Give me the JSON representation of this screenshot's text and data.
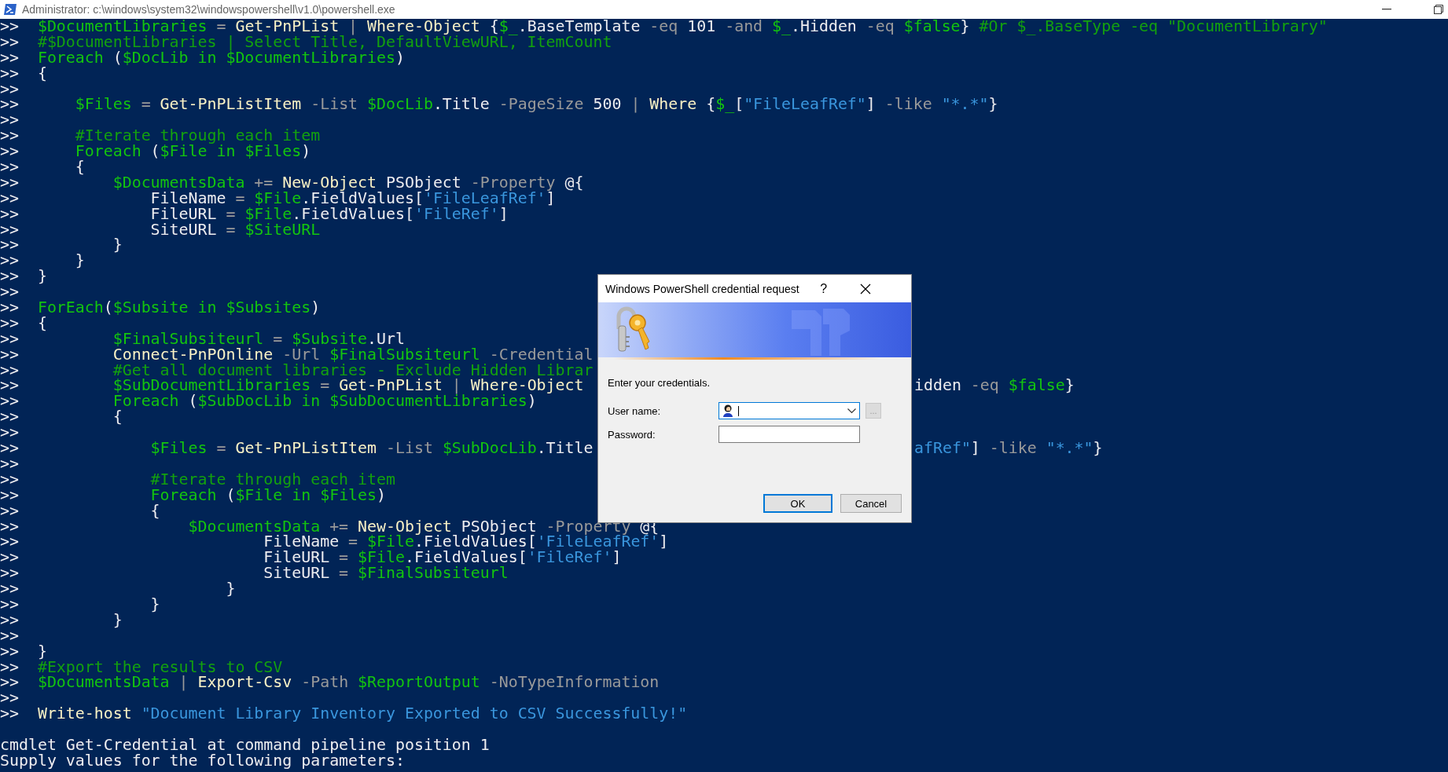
{
  "window": {
    "title": "Administrator: c:\\windows\\system32\\windowspowershell\\v1.0\\powershell.exe"
  },
  "console": {
    "lines": [
      {
        "kind": "input",
        "prompt": ">>",
        "tokens": [
          {
            "kind": "var",
            "text": "  $DocumentLibraries"
          },
          {
            "kind": "op",
            "text": " = "
          },
          {
            "kind": "cmd",
            "text": "Get-PnPList"
          },
          {
            "kind": "op",
            "text": " | "
          },
          {
            "kind": "cmd",
            "text": "Where-Object"
          },
          {
            "kind": "txt",
            "text": " {"
          },
          {
            "kind": "var",
            "text": "$_"
          },
          {
            "kind": "txt",
            "text": ".BaseTemplate"
          },
          {
            "kind": "param",
            "text": " -eq "
          },
          {
            "kind": "txt",
            "text": "101"
          },
          {
            "kind": "param",
            "text": " -and "
          },
          {
            "kind": "var",
            "text": "$_"
          },
          {
            "kind": "txt",
            "text": ".Hidden"
          },
          {
            "kind": "param",
            "text": " -eq "
          },
          {
            "kind": "var",
            "text": "$false"
          },
          {
            "kind": "txt",
            "text": "} "
          },
          {
            "kind": "com",
            "text": "#Or $_.BaseType -eq \"DocumentLibrary\""
          }
        ]
      },
      {
        "kind": "input",
        "prompt": ">>",
        "tokens": [
          {
            "kind": "com",
            "text": "  #$DocumentLibraries | Select Title, DefaultViewURL, ItemCount"
          }
        ]
      },
      {
        "kind": "input",
        "prompt": ">>",
        "tokens": [
          {
            "kind": "kw",
            "text": "  Foreach"
          },
          {
            "kind": "txt",
            "text": " ("
          },
          {
            "kind": "var",
            "text": "$DocLib"
          },
          {
            "kind": "kw",
            "text": " in "
          },
          {
            "kind": "var",
            "text": "$DocumentLibraries"
          },
          {
            "kind": "txt",
            "text": ")"
          }
        ]
      },
      {
        "kind": "input",
        "prompt": ">>",
        "tokens": [
          {
            "kind": "txt",
            "text": "  {"
          }
        ]
      },
      {
        "kind": "input",
        "prompt": ">>"
      },
      {
        "kind": "input",
        "prompt": ">>",
        "tokens": [
          {
            "kind": "var",
            "text": "      $Files"
          },
          {
            "kind": "op",
            "text": " = "
          },
          {
            "kind": "cmd",
            "text": "Get-PnPListItem"
          },
          {
            "kind": "param",
            "text": " -List "
          },
          {
            "kind": "var",
            "text": "$DocLib"
          },
          {
            "kind": "txt",
            "text": ".Title"
          },
          {
            "kind": "param",
            "text": " -PageSize "
          },
          {
            "kind": "txt",
            "text": "500"
          },
          {
            "kind": "op",
            "text": " | "
          },
          {
            "kind": "cmd",
            "text": "Where"
          },
          {
            "kind": "txt",
            "text": " {"
          },
          {
            "kind": "var",
            "text": "$_"
          },
          {
            "kind": "txt",
            "text": "["
          },
          {
            "kind": "str",
            "text": "\"FileLeafRef\""
          },
          {
            "kind": "txt",
            "text": "] "
          },
          {
            "kind": "param",
            "text": "-like "
          },
          {
            "kind": "str",
            "text": "\"*.*\""
          },
          {
            "kind": "txt",
            "text": "}"
          }
        ]
      },
      {
        "kind": "input",
        "prompt": ">>"
      },
      {
        "kind": "input",
        "prompt": ">>",
        "tokens": [
          {
            "kind": "com",
            "text": "      #Iterate through each item"
          }
        ]
      },
      {
        "kind": "input",
        "prompt": ">>",
        "tokens": [
          {
            "kind": "kw",
            "text": "      Foreach"
          },
          {
            "kind": "txt",
            "text": " ("
          },
          {
            "kind": "var",
            "text": "$File"
          },
          {
            "kind": "kw",
            "text": " in "
          },
          {
            "kind": "var",
            "text": "$Files"
          },
          {
            "kind": "txt",
            "text": ")"
          }
        ]
      },
      {
        "kind": "input",
        "prompt": ">>",
        "tokens": [
          {
            "kind": "txt",
            "text": "      {"
          }
        ]
      },
      {
        "kind": "input",
        "prompt": ">>",
        "tokens": [
          {
            "kind": "var",
            "text": "          $DocumentsData"
          },
          {
            "kind": "op",
            "text": " += "
          },
          {
            "kind": "cmd",
            "text": "New-Object"
          },
          {
            "kind": "txt",
            "text": " PSObject"
          },
          {
            "kind": "param",
            "text": " -Property "
          },
          {
            "kind": "txt",
            "text": "@{"
          }
        ]
      },
      {
        "kind": "input",
        "prompt": ">>",
        "tokens": [
          {
            "kind": "txt",
            "text": "              FileName "
          },
          {
            "kind": "op",
            "text": "= "
          },
          {
            "kind": "var",
            "text": "$File"
          },
          {
            "kind": "txt",
            "text": ".FieldValues["
          },
          {
            "kind": "str",
            "text": "'FileLeafRef'"
          },
          {
            "kind": "txt",
            "text": "]"
          }
        ]
      },
      {
        "kind": "input",
        "prompt": ">>",
        "tokens": [
          {
            "kind": "txt",
            "text": "              FileURL "
          },
          {
            "kind": "op",
            "text": "= "
          },
          {
            "kind": "var",
            "text": "$File"
          },
          {
            "kind": "txt",
            "text": ".FieldValues["
          },
          {
            "kind": "str",
            "text": "'FileRef'"
          },
          {
            "kind": "txt",
            "text": "]"
          }
        ]
      },
      {
        "kind": "input",
        "prompt": ">>",
        "tokens": [
          {
            "kind": "txt",
            "text": "              SiteURL "
          },
          {
            "kind": "op",
            "text": "= "
          },
          {
            "kind": "var",
            "text": "$SiteURL"
          }
        ]
      },
      {
        "kind": "input",
        "prompt": ">>",
        "tokens": [
          {
            "kind": "txt",
            "text": "          }"
          }
        ]
      },
      {
        "kind": "input",
        "prompt": ">>",
        "tokens": [
          {
            "kind": "txt",
            "text": "      }"
          }
        ]
      },
      {
        "kind": "input",
        "prompt": ">>",
        "tokens": [
          {
            "kind": "txt",
            "text": "  }"
          }
        ]
      },
      {
        "kind": "input",
        "prompt": ">>"
      },
      {
        "kind": "input",
        "prompt": ">>",
        "tokens": [
          {
            "kind": "kw",
            "text": "  ForEach"
          },
          {
            "kind": "txt",
            "text": "("
          },
          {
            "kind": "var",
            "text": "$Subsite"
          },
          {
            "kind": "kw",
            "text": " in "
          },
          {
            "kind": "var",
            "text": "$Subsites"
          },
          {
            "kind": "txt",
            "text": ")"
          }
        ]
      },
      {
        "kind": "input",
        "prompt": ">>",
        "tokens": [
          {
            "kind": "txt",
            "text": "  {"
          }
        ]
      },
      {
        "kind": "input",
        "prompt": ">>",
        "tokens": [
          {
            "kind": "var",
            "text": "          $FinalSubsiteurl"
          },
          {
            "kind": "op",
            "text": " = "
          },
          {
            "kind": "var",
            "text": "$Subsite"
          },
          {
            "kind": "txt",
            "text": ".Url"
          }
        ]
      },
      {
        "kind": "input",
        "prompt": ">>",
        "tokens": [
          {
            "kind": "cmd",
            "text": "          Connect-PnPOnline"
          },
          {
            "kind": "param",
            "text": " -Url "
          },
          {
            "kind": "var",
            "text": "$FinalSubsiteurl"
          },
          {
            "kind": "param",
            "text": " -Credential"
          }
        ]
      },
      {
        "kind": "input",
        "prompt": ">>",
        "tokens": [
          {
            "kind": "com",
            "text": "          #Get all document libraries - Exclude Hidden Librar"
          }
        ]
      },
      {
        "kind": "input",
        "prompt": ">>",
        "tokens": [
          {
            "kind": "var",
            "text": "          $SubDocumentLibraries"
          },
          {
            "kind": "op",
            "text": " = "
          },
          {
            "kind": "cmd",
            "text": "Get-PnPList"
          },
          {
            "kind": "op",
            "text": " | "
          },
          {
            "kind": "cmd",
            "text": "Where-Object"
          }
        ],
        "tokens_after_dialog": [
          {
            "kind": "txt",
            "text": "idden"
          },
          {
            "kind": "param",
            "text": " -eq "
          },
          {
            "kind": "var",
            "text": "$false"
          },
          {
            "kind": "txt",
            "text": "}"
          }
        ]
      },
      {
        "kind": "input",
        "prompt": ">>",
        "tokens": [
          {
            "kind": "kw",
            "text": "          Foreach"
          },
          {
            "kind": "txt",
            "text": " ("
          },
          {
            "kind": "var",
            "text": "$SubDocLib"
          },
          {
            "kind": "kw",
            "text": " in "
          },
          {
            "kind": "var",
            "text": "$SubDocumentLibraries"
          },
          {
            "kind": "txt",
            "text": ")"
          }
        ]
      },
      {
        "kind": "input",
        "prompt": ">>",
        "tokens": [
          {
            "kind": "txt",
            "text": "          {"
          }
        ]
      },
      {
        "kind": "input",
        "prompt": ">>"
      },
      {
        "kind": "input",
        "prompt": ">>",
        "tokens": [
          {
            "kind": "var",
            "text": "              $Files"
          },
          {
            "kind": "op",
            "text": " = "
          },
          {
            "kind": "cmd",
            "text": "Get-PnPListItem"
          },
          {
            "kind": "param",
            "text": " -List "
          },
          {
            "kind": "var",
            "text": "$SubDocLib"
          },
          {
            "kind": "txt",
            "text": ".Title"
          }
        ],
        "tokens_after_dialog": [
          {
            "kind": "str",
            "text": "afRef\""
          },
          {
            "kind": "txt",
            "text": "] "
          },
          {
            "kind": "param",
            "text": "-like "
          },
          {
            "kind": "str",
            "text": "\"*.*\""
          },
          {
            "kind": "txt",
            "text": "}"
          }
        ]
      },
      {
        "kind": "input",
        "prompt": ">>"
      },
      {
        "kind": "input",
        "prompt": ">>",
        "tokens": [
          {
            "kind": "com",
            "text": "              #Iterate through each item"
          }
        ]
      },
      {
        "kind": "input",
        "prompt": ">>",
        "tokens": [
          {
            "kind": "kw",
            "text": "              Foreach"
          },
          {
            "kind": "txt",
            "text": " ("
          },
          {
            "kind": "var",
            "text": "$File"
          },
          {
            "kind": "kw",
            "text": " in "
          },
          {
            "kind": "var",
            "text": "$Files"
          },
          {
            "kind": "txt",
            "text": ")"
          }
        ]
      },
      {
        "kind": "input",
        "prompt": ">>",
        "tokens": [
          {
            "kind": "txt",
            "text": "              {"
          }
        ]
      },
      {
        "kind": "input",
        "prompt": ">>",
        "tokens": [
          {
            "kind": "var",
            "text": "                  $DocumentsData"
          },
          {
            "kind": "op",
            "text": " += "
          },
          {
            "kind": "cmd",
            "text": "New-Object"
          },
          {
            "kind": "txt",
            "text": " PSObject"
          },
          {
            "kind": "param",
            "text": " -Property "
          },
          {
            "kind": "txt",
            "text": "@{"
          }
        ]
      },
      {
        "kind": "input",
        "prompt": ">>",
        "tokens": [
          {
            "kind": "txt",
            "text": "                          FileName "
          },
          {
            "kind": "op",
            "text": "= "
          },
          {
            "kind": "var",
            "text": "$File"
          },
          {
            "kind": "txt",
            "text": ".FieldValues["
          },
          {
            "kind": "str",
            "text": "'FileLeafRef'"
          },
          {
            "kind": "txt",
            "text": "]"
          }
        ]
      },
      {
        "kind": "input",
        "prompt": ">>",
        "tokens": [
          {
            "kind": "txt",
            "text": "                          FileURL "
          },
          {
            "kind": "op",
            "text": "= "
          },
          {
            "kind": "var",
            "text": "$File"
          },
          {
            "kind": "txt",
            "text": ".FieldValues["
          },
          {
            "kind": "str",
            "text": "'FileRef'"
          },
          {
            "kind": "txt",
            "text": "]"
          }
        ]
      },
      {
        "kind": "input",
        "prompt": ">>",
        "tokens": [
          {
            "kind": "txt",
            "text": "                          SiteURL "
          },
          {
            "kind": "op",
            "text": "= "
          },
          {
            "kind": "var",
            "text": "$FinalSubsiteurl"
          }
        ]
      },
      {
        "kind": "input",
        "prompt": ">>",
        "tokens": [
          {
            "kind": "txt",
            "text": "                      }"
          }
        ]
      },
      {
        "kind": "input",
        "prompt": ">>",
        "tokens": [
          {
            "kind": "txt",
            "text": "              }"
          }
        ]
      },
      {
        "kind": "input",
        "prompt": ">>",
        "tokens": [
          {
            "kind": "txt",
            "text": "          }"
          }
        ]
      },
      {
        "kind": "input",
        "prompt": ">>"
      },
      {
        "kind": "input",
        "prompt": ">>",
        "tokens": [
          {
            "kind": "txt",
            "text": "  }"
          }
        ]
      },
      {
        "kind": "input",
        "prompt": ">>",
        "tokens": [
          {
            "kind": "com",
            "text": "  #Export the results to CSV"
          }
        ]
      },
      {
        "kind": "input",
        "prompt": ">>",
        "tokens": [
          {
            "kind": "var",
            "text": "  $DocumentsData"
          },
          {
            "kind": "op",
            "text": " | "
          },
          {
            "kind": "cmd",
            "text": "Export-Csv"
          },
          {
            "kind": "param",
            "text": " -Path "
          },
          {
            "kind": "var",
            "text": "$ReportOutput"
          },
          {
            "kind": "param",
            "text": " -NoTypeInformation"
          }
        ]
      },
      {
        "kind": "input",
        "prompt": ">>"
      },
      {
        "kind": "input",
        "prompt": ">>",
        "tokens": [
          {
            "kind": "cmd",
            "text": "  Write-host "
          },
          {
            "kind": "str",
            "text": "\"Document Library Inventory Exported to CSV Successfully!\""
          }
        ]
      },
      {
        "kind": "blank"
      },
      {
        "kind": "output",
        "text": "cmdlet Get-Credential at command pipeline position 1"
      },
      {
        "kind": "output",
        "text": "Supply values for the following parameters:"
      }
    ]
  },
  "dialog": {
    "title": "Windows PowerShell credential request",
    "help_button": "?",
    "message": "Enter your credentials.",
    "fields": [
      {
        "label": "User name:",
        "kind": "combo",
        "focused": true
      },
      {
        "label": "Password:",
        "kind": "password",
        "focused": false
      }
    ],
    "browse_button": {
      "label": "...",
      "disabled": true
    },
    "buttons": [
      {
        "label": "OK",
        "default": true
      },
      {
        "label": "Cancel",
        "default": false
      }
    ]
  }
}
